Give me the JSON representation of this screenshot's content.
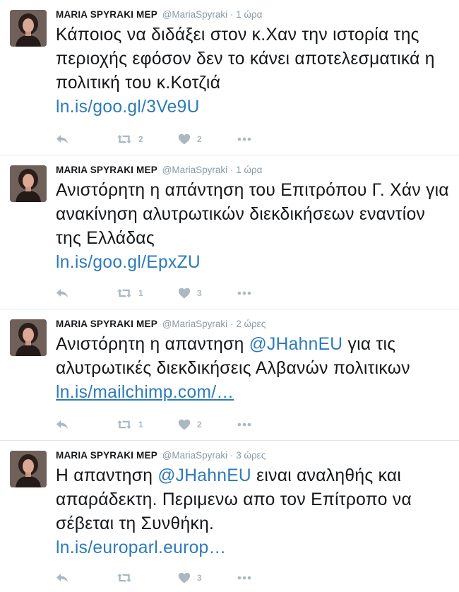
{
  "tweets": [
    {
      "name": "MARIA SPYRAKI MEP",
      "handle": "@MariaSpyraki",
      "sep": "·",
      "time": "1 ώρα",
      "text": "Κάποιος  να διδάξει στον κ.Χαν την ιστορία της περιοχής εφόσον δεν το κάνει αποτελεσματικά η πολιτική του κ.Κοτζιά",
      "mention": "",
      "text_after": "",
      "link": "ln.is/goo.gl/3Ve9U",
      "retweets": "2",
      "likes": "2"
    },
    {
      "name": "MARIA SPYRAKI MEP",
      "handle": "@MariaSpyraki",
      "sep": "·",
      "time": "1 ώρα",
      "text": "Ανιστόρητη η απάντηση του Επιτρόπου Γ. Χάν για ανακίνηση αλυτρωτικών διεκδικήσεων εναντίον της Ελλάδας",
      "mention": "",
      "text_after": "",
      "link": "ln.is/goo.gl/EpxZU",
      "retweets": "1",
      "likes": "3"
    },
    {
      "name": "MARIA SPYRAKI MEP",
      "handle": "@MariaSpyraki",
      "sep": "·",
      "time": "2 ώρες",
      "text": "Ανιστόρητη η απαντηση",
      "mention": "@JHahnEU",
      "text_after": "για τις αλυτρωτικές διεκδικήσεις Αλβανών πολιτικων",
      "link": "ln.is/mailchimp.com/…",
      "retweets": "1",
      "likes": "2"
    },
    {
      "name": "MARIA SPYRAKI MEP",
      "handle": "@MariaSpyraki",
      "sep": "·",
      "time": "3 ώρες",
      "text": "Η απαντηση",
      "mention": "@JHahnEU",
      "text_after": "ειναι αναληθής και απαράδεκτη. Περιμενω απο τον Επίτροπο να σέβεται τη Συνθήκη.",
      "link": "ln.is/europarl.europ…",
      "retweets": "",
      "likes": "3"
    }
  ],
  "icons": {
    "reply": "reply-icon",
    "retweet": "retweet-icon",
    "like": "heart-icon",
    "more": "more-icon"
  },
  "colors": {
    "link": "#2b7bb9",
    "meta": "#8899a6",
    "action": "#aab8c2",
    "divider": "#e1e8ed"
  }
}
